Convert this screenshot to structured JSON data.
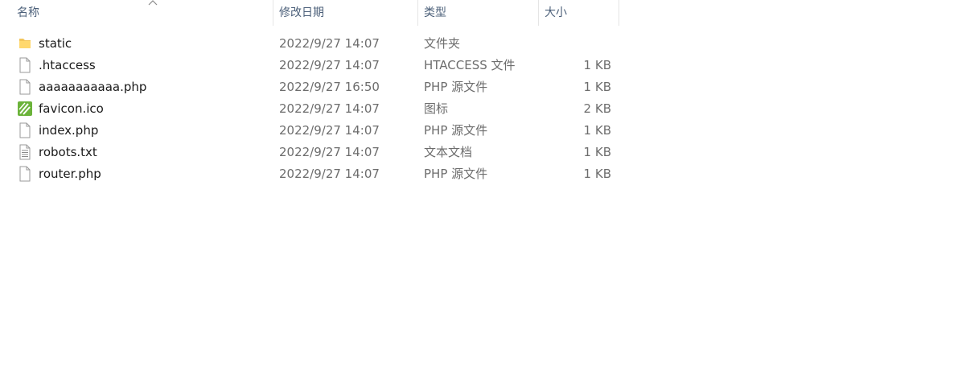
{
  "columns": {
    "name": "名称",
    "date": "修改日期",
    "type": "类型",
    "size": "大小"
  },
  "files": [
    {
      "name": "static",
      "date": "2022/9/27 14:07",
      "type": "文件夹",
      "size": "",
      "icon": "folder-icon"
    },
    {
      "name": ".htaccess",
      "date": "2022/9/27 14:07",
      "type": "HTACCESS 文件",
      "size": "1 KB",
      "icon": "file-icon"
    },
    {
      "name": "aaaaaaaaaaa.php",
      "date": "2022/9/27 16:50",
      "type": "PHP 源文件",
      "size": "1 KB",
      "icon": "file-icon"
    },
    {
      "name": "favicon.ico",
      "date": "2022/9/27 14:07",
      "type": "图标",
      "size": "2 KB",
      "icon": "favicon-icon"
    },
    {
      "name": "index.php",
      "date": "2022/9/27 14:07",
      "type": "PHP 源文件",
      "size": "1 KB",
      "icon": "file-icon"
    },
    {
      "name": "robots.txt",
      "date": "2022/9/27 14:07",
      "type": "文本文档",
      "size": "1 KB",
      "icon": "text-file-icon"
    },
    {
      "name": "router.php",
      "date": "2022/9/27 14:07",
      "type": "PHP 源文件",
      "size": "1 KB",
      "icon": "file-icon"
    }
  ]
}
